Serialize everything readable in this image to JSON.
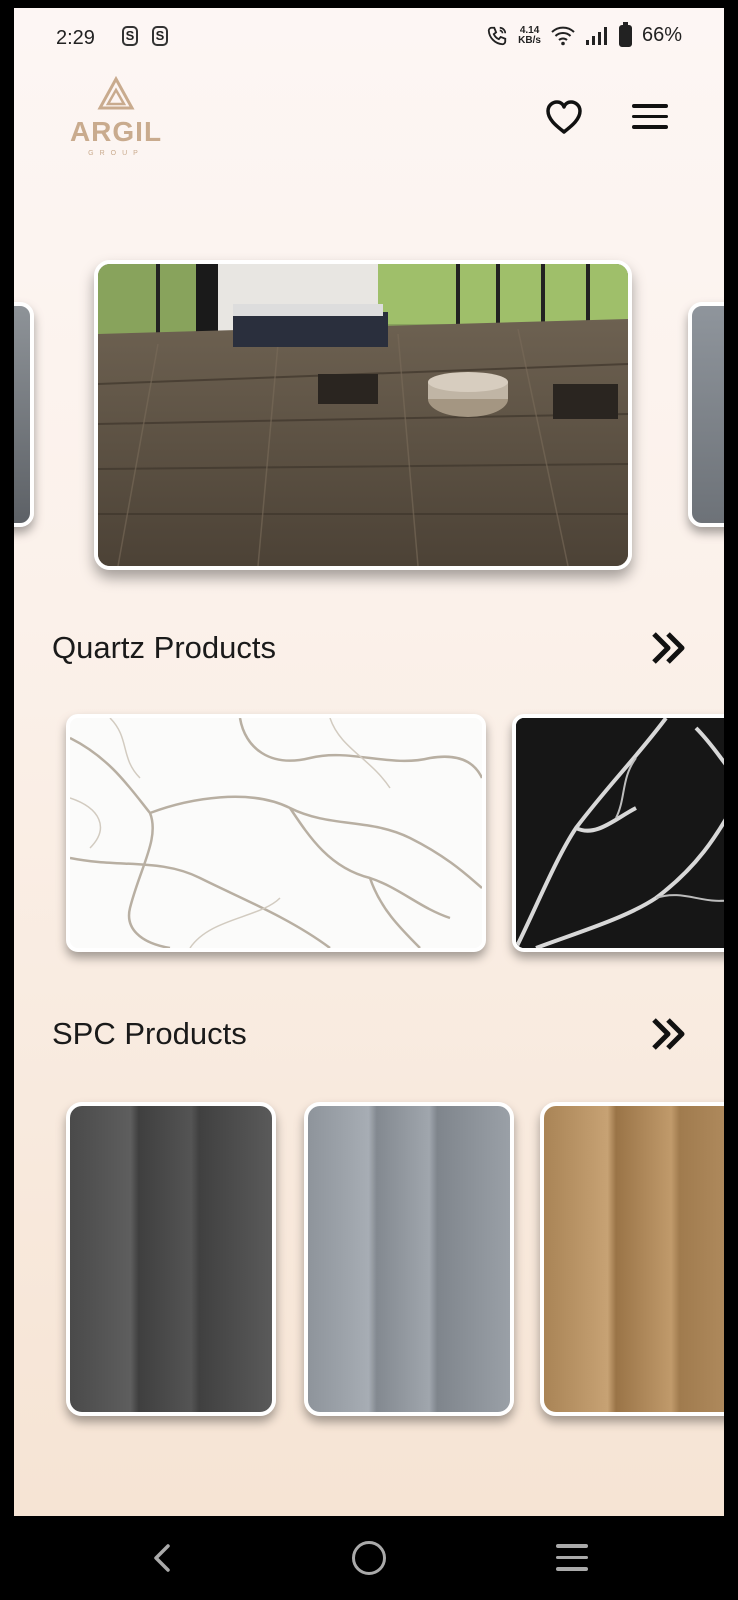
{
  "status_bar": {
    "time": "2:29",
    "s_icon": "S",
    "speed_value": "4.14",
    "speed_unit": "KB/s",
    "battery": "66%"
  },
  "header": {
    "logo_text": "ARGIL",
    "logo_subtext": "GROUP",
    "favorites_icon": "heart-icon",
    "menu_icon": "hamburger-menu-icon"
  },
  "sections": {
    "quartz": {
      "title": "Quartz Products",
      "see_all_icon": "double-chevron-right-icon"
    },
    "spc": {
      "title": "SPC Products",
      "see_all_icon": "double-chevron-right-icon"
    }
  },
  "nav_bar": {
    "back_icon": "back-icon",
    "home_icon": "home-icon",
    "recent_icon": "recent-apps-icon"
  },
  "colors": {
    "accent_logo": "#c9ab8e",
    "background_top": "#fdf6f4",
    "background_bottom": "#f6e4d4"
  }
}
